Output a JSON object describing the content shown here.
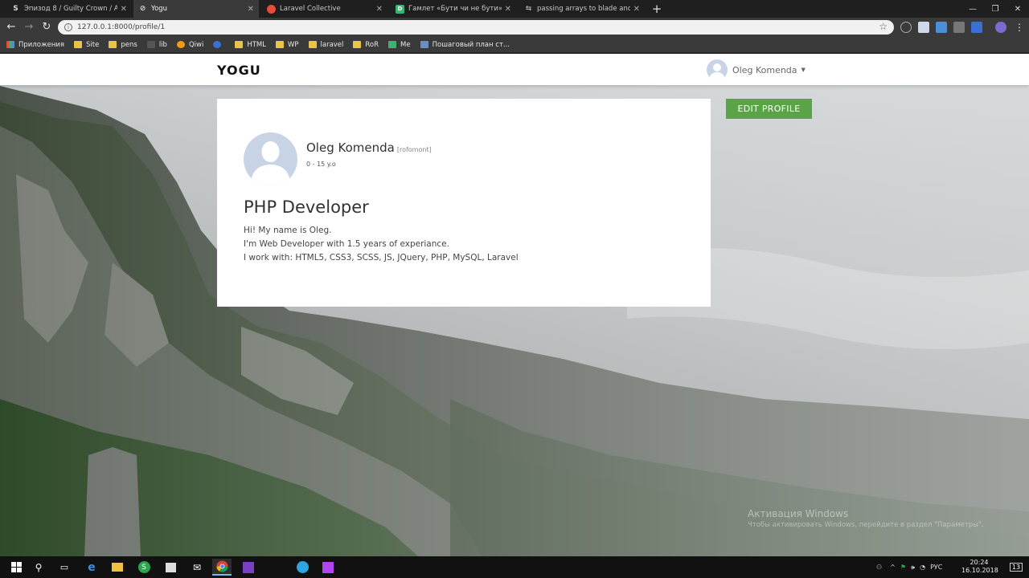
{
  "browser": {
    "tabs": [
      {
        "title": "Эпизод 8 / Guilty Crown / Аним",
        "favicon": "s-icon",
        "active": false
      },
      {
        "title": "Yogu",
        "favicon": "chrome-blank-icon",
        "active": true
      },
      {
        "title": "Laravel Collective",
        "favicon": "laravel-collective-icon",
        "active": false
      },
      {
        "title": "Гамлет «Бути чи не бути» | Dov",
        "favicon": "d-icon",
        "active": false
      },
      {
        "title": "passing arrays to blade and itera",
        "favicon": "arrows-icon",
        "active": false
      }
    ],
    "new_tab": "+",
    "url": "127.0.0.1:8000/profile/1",
    "bookmarks": [
      "Приложения",
      "Site",
      "pens",
      "lib",
      "Qiwi",
      "HTML",
      "WP",
      "laravel",
      "RoR",
      "Me",
      "Пошаговый план ст..."
    ]
  },
  "site": {
    "logo": "YOGU",
    "user_menu_name": "Oleg Komenda",
    "edit_profile_label": "EDIT PROFILE"
  },
  "profile": {
    "name": "Oleg Komenda",
    "username": "[rofomont]",
    "age": "0 - 15 y.o",
    "title": "PHP Developer",
    "bio": [
      "Hi! My name is Oleg.",
      "I'm Web Developer with 1.5 years of experiance.",
      "I work with: HTML5, CSS3, SCSS, JS, JQuery, PHP, MySQL, Laravel"
    ]
  },
  "os": {
    "watermark_title": "Активация Windows",
    "watermark_text": "Чтобы активировать Windows, перейдите в раздел \"Параметры\".",
    "language": "РУС",
    "time": "20:24",
    "date": "16.10.2018",
    "notification_count": "13"
  },
  "colors": {
    "accent_green": "#5aa447",
    "avatar_bg": "#c9d3e6",
    "browser_dark": "#3a3a3a"
  }
}
